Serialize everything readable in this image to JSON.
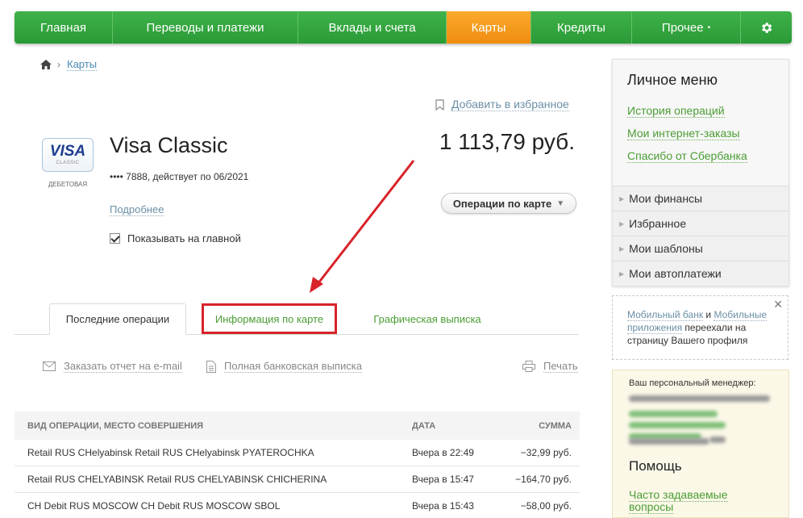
{
  "nav": {
    "items": [
      {
        "label": "Главная"
      },
      {
        "label": "Переводы и платежи"
      },
      {
        "label": "Вклады и счета"
      },
      {
        "label": "Карты"
      },
      {
        "label": "Кредиты"
      },
      {
        "label": "Прочее"
      }
    ],
    "settings_icon": "gear-icon",
    "active_color": "#f5a01d",
    "base_color": "#2fa33d"
  },
  "breadcrumb": {
    "home_icon": "home-icon",
    "current": "Карты"
  },
  "favorites": {
    "label": "Добавить в избранное",
    "icon": "bookmark-icon"
  },
  "card": {
    "logo_text": "VISA",
    "logo_sub": "CLASSIC",
    "type": "ДЕБЕТОВАЯ",
    "title": "Visa Classic",
    "number": "•••• 7888, действует по 06/2021",
    "more": "Подробнее",
    "show_on_main": "Показывать на главной",
    "balance": "1 113,79 руб.",
    "operations_button": "Операции по карте"
  },
  "tabs": [
    {
      "label": "Последние операции"
    },
    {
      "label": "Информация по карте"
    },
    {
      "label": "Графическая выписка"
    }
  ],
  "actions": {
    "email_report": "Заказать отчет на e-mail",
    "full_statement": "Полная банковская выписка",
    "print": "Печать"
  },
  "table": {
    "headers": [
      "Вид операции, место совершения",
      "Дата",
      "Сумма"
    ],
    "rows": [
      {
        "desc": "Retail RUS CHelyabinsk Retail RUS CHelyabinsk PYATEROCHKA",
        "date": "Вчера в 22:49",
        "sum": "−32,99 руб."
      },
      {
        "desc": "Retail RUS CHELYABINSK Retail RUS CHELYABINSK CHICHERINA",
        "date": "Вчера в 15:47",
        "sum": "−164,70 руб."
      },
      {
        "desc": "CH Debit RUS MOSCOW CH Debit RUS MOSCOW SBOL",
        "date": "Вчера в 15:43",
        "sum": "−58,00 руб."
      }
    ]
  },
  "personal_menu": {
    "title": "Личное меню",
    "links": [
      "История операций",
      "Мои интернет-заказы",
      "Спасибо от Сбербанка"
    ],
    "sections": [
      "Мои финансы",
      "Избранное",
      "Мои шаблоны",
      "Мои автоплатежи"
    ]
  },
  "notice": {
    "link1": "Мобильный банк",
    "and": " и ",
    "link2": "Мобильные приложения",
    "text": " переехали на страницу Вашего профиля"
  },
  "manager": {
    "label": "Ваш персональный менеджер:",
    "help_title": "Помощь",
    "faq": "Часто задаваемые вопросы"
  },
  "colors": {
    "link_green": "#4a9d34",
    "highlight_red": "#d8232a"
  }
}
